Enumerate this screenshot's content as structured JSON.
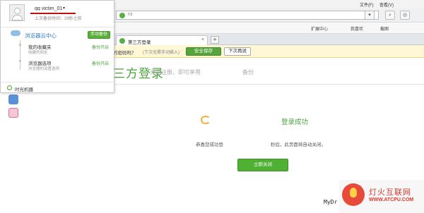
{
  "menu": {
    "file": "文件(F)",
    "view": "查看(V)"
  },
  "address": {
    "text": "htt"
  },
  "favorites": [
    {
      "label": "扩展中心"
    },
    {
      "label": "我喜欢"
    },
    {
      "label": "截图"
    }
  ],
  "tab": {
    "label": "第三方登录",
    "close": "×",
    "new": "+"
  },
  "password_bar": {
    "question": "的密码吗？",
    "note": "(下次无需手动输入)",
    "save": "安全保存",
    "later": "下次再说"
  },
  "page": {
    "title": "三方登录",
    "subtitle": "无需注册、即可享用",
    "subtitle_tail": "备份",
    "success": "登录成功",
    "closing_1": "恭喜您成功登",
    "closing_2": "秒后，此页面将自动关闭。",
    "close_now": "立即关闭",
    "watermark": "MyDr"
  },
  "cloud_panel": {
    "username": "qq victim_01",
    "username_arrow": "▾",
    "backup_time": "上次备份时间：29秒之前",
    "title": "浏览器云中心",
    "manual_backup": "手动备份",
    "items": [
      {
        "label": "我的收藏夹",
        "sub": "收藏的网址",
        "status": "备份开启"
      },
      {
        "label": "浏览器选项",
        "sub": "浏览器的设置选项",
        "status": "备份开启"
      }
    ],
    "time_machine": "时光机器"
  },
  "badge": {
    "cn": "灯火互联网",
    "en": "WWW.ATCPU.COM"
  },
  "colors": {
    "accent_green": "#4aa23a",
    "link_blue": "#2e7bbf",
    "alert_red": "#c01010"
  },
  "icons": [
    "cloud-icon",
    "time-machine-icon",
    "phone-icon",
    "settings-icon",
    "avatar-icon"
  ]
}
